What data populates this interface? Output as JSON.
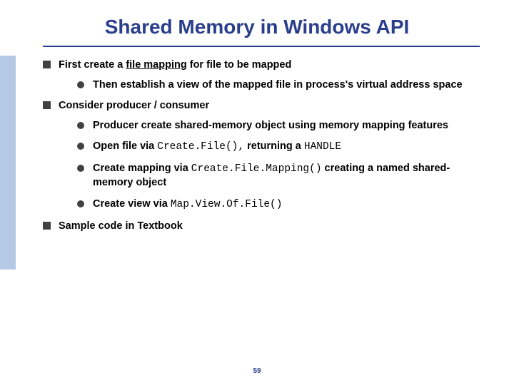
{
  "title": "Shared Memory in Windows API",
  "b1": "First create a ",
  "b1_bold": "file mapping",
  "b1_after": " for file to be mapped",
  "b1_1": "Then establish a view of the mapped file in process's virtual address space",
  "b2": "Consider producer / consumer",
  "b2_1": "Producer create shared-memory object using memory mapping features",
  "b2_2a": "Open file via ",
  "b2_2code": "Create.File(),",
  "b2_2b": " returning a ",
  "b2_2code2": " HANDLE",
  "b2_3a": "Create mapping via ",
  "b2_3code": "Create.File.Mapping()",
  "b2_3b": " creating a ",
  "b2_3bold": "named shared-memory object",
  "b2_4a": "Create view via ",
  "b2_4code": "Map.View.Of.File()",
  "b3": "Sample code in Textbook",
  "page": "59"
}
